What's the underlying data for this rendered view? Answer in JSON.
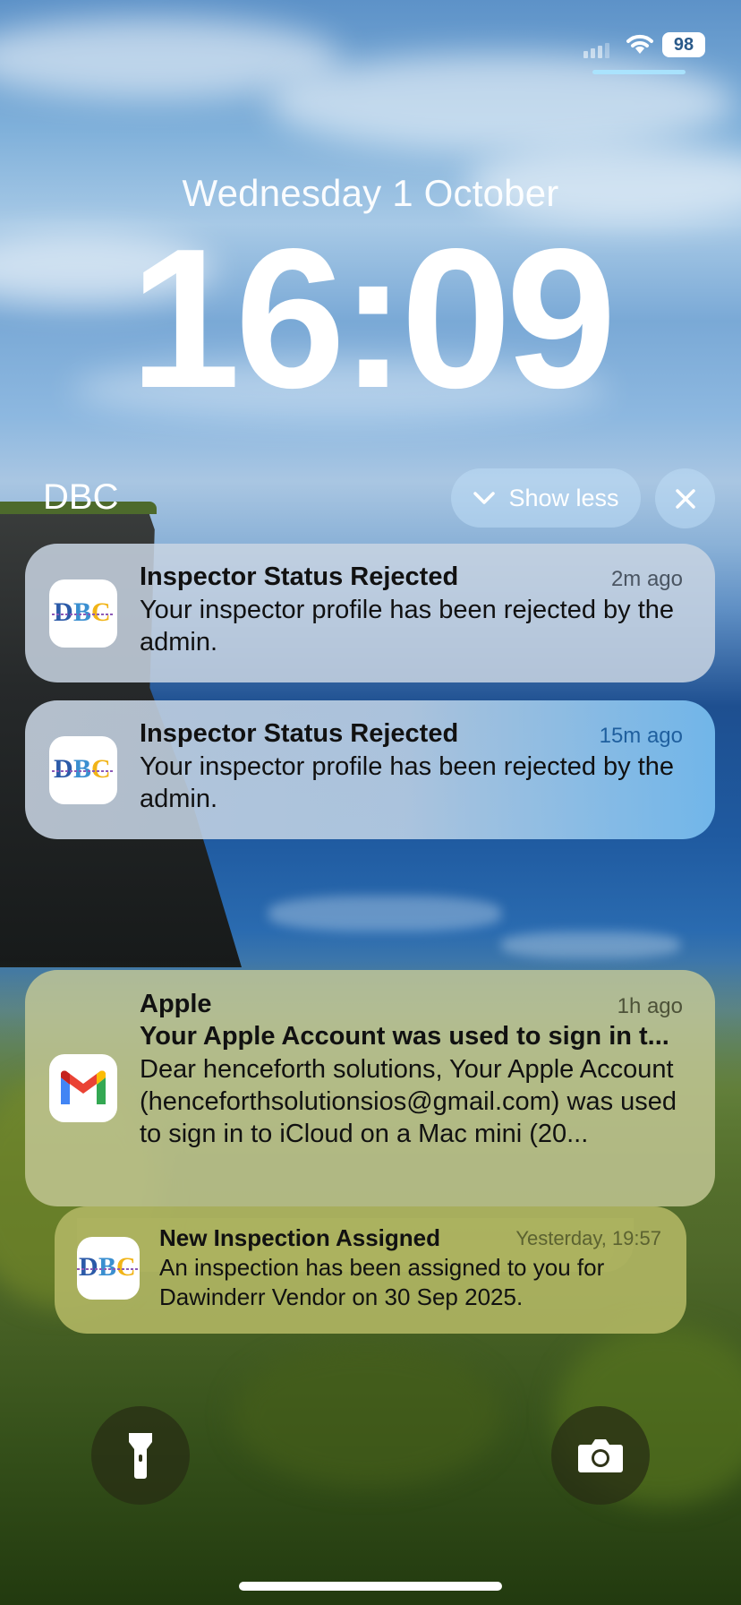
{
  "status_bar": {
    "battery_level": "98",
    "icons": [
      "cellular-signal-icon",
      "wifi-icon",
      "battery-icon"
    ]
  },
  "lock_screen": {
    "date": "Wednesday 1 October",
    "time": "16:09"
  },
  "notification_group": {
    "app_name": "DBC",
    "show_less_label": "Show less",
    "icons": [
      "chevron-down-icon",
      "close-icon"
    ]
  },
  "notifications": [
    {
      "app_icon": "dbc-logo-icon",
      "title": "Inspector Status Rejected",
      "time": "2m ago",
      "body": "Your inspector profile has been rejected by the admin."
    },
    {
      "app_icon": "dbc-logo-icon",
      "title": "Inspector Status Rejected",
      "time": "15m ago",
      "body": "Your inspector profile has been rejected by the admin."
    },
    {
      "app_icon": "gmail-icon",
      "sender": "Apple",
      "time": "1h ago",
      "title": "Your Apple Account was used to sign in t...",
      "body": "Dear henceforth solutions, Your Apple Account (henceforthsolutionsios@gmail.com) was used to sign in to iCloud on a Mac mini (20..."
    },
    {
      "app_icon": "dbc-logo-icon",
      "title": "New Inspection Assigned",
      "time": "Yesterday, 19:57",
      "body": "An inspection has been assigned to you for Dawinderr Vendor on 30 Sep 2025."
    }
  ],
  "quick_actions": {
    "left": "flashlight-icon",
    "right": "camera-icon"
  },
  "colors": {
    "accent_time_blue": "#2a6fb0",
    "gmail_red": "#ea4335",
    "gmail_blue": "#4285f4",
    "gmail_green": "#34a853",
    "gmail_yellow": "#fbbc04"
  }
}
